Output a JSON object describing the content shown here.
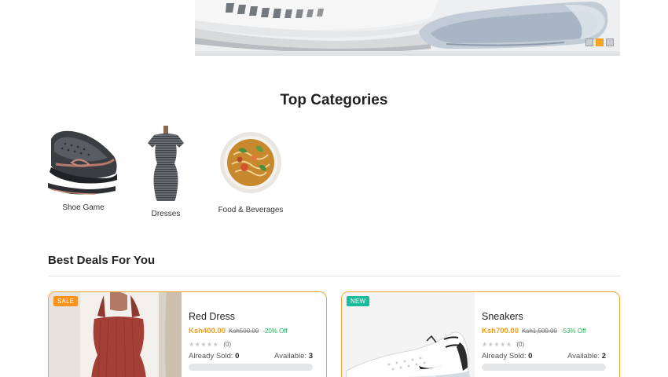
{
  "banner": {
    "image": "sneaker-banner-image",
    "slides": 3,
    "active_slide": 2
  },
  "categories": {
    "title": "Top Categories",
    "items": [
      {
        "label": "Shoe Game",
        "image": "loafer-shoe-image"
      },
      {
        "label": "Dresses",
        "image": "striped-dress-image"
      },
      {
        "label": "Food & Beverages",
        "image": "noodle-soup-image"
      }
    ]
  },
  "deals": {
    "title": "Best Deals For You",
    "products": [
      {
        "badge": "SALE",
        "name": "Red Dress",
        "price": "Ksh400.00",
        "old_price": "Ksh500.00",
        "discount": "-20% Off",
        "rating_stars": "★★★★★",
        "rating_count": "(0)",
        "sold_label": "Already Sold:",
        "sold": "0",
        "available_label": "Available:",
        "available": "3"
      },
      {
        "badge": "NEW",
        "name": "Sneakers",
        "price": "Ksh700.00",
        "old_price": "Ksh1,500.00",
        "discount": "-53% Off",
        "rating_stars": "★★★★★",
        "rating_count": "(0)",
        "sold_label": "Already Sold:",
        "sold": "0",
        "available_label": "Available:",
        "available": "2"
      }
    ]
  },
  "colors": {
    "accent": "#f39c12",
    "discount": "#27ae60",
    "new_badge": "#1abc9c"
  }
}
